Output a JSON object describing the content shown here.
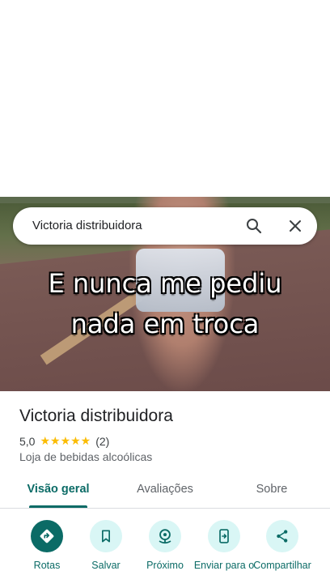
{
  "search": {
    "query": "Victoria distribuidora"
  },
  "hero": {
    "caption_line1": "E nunca me pediu",
    "caption_line2": "nada em troca"
  },
  "place": {
    "name": "Victoria distribuidora",
    "rating": "5,0",
    "stars": "★★★★★",
    "reviews": "(2)",
    "category": "Loja de bebidas alcoólicas"
  },
  "tabs": [
    {
      "label": "Visão geral",
      "active": true
    },
    {
      "label": "Avaliações",
      "active": false
    },
    {
      "label": "Sobre",
      "active": false
    }
  ],
  "actions": [
    {
      "label": "Rotas",
      "icon": "directions-icon"
    },
    {
      "label": "Salvar",
      "icon": "bookmark-icon"
    },
    {
      "label": "Próximo",
      "icon": "nearby-icon"
    },
    {
      "label": "Enviar para o",
      "icon": "send-to-phone-icon"
    },
    {
      "label": "Compartilhar",
      "icon": "share-icon"
    }
  ],
  "colors": {
    "accent": "#0b6b66",
    "accent_light": "#d9f6f5",
    "star": "#fbbc04"
  }
}
